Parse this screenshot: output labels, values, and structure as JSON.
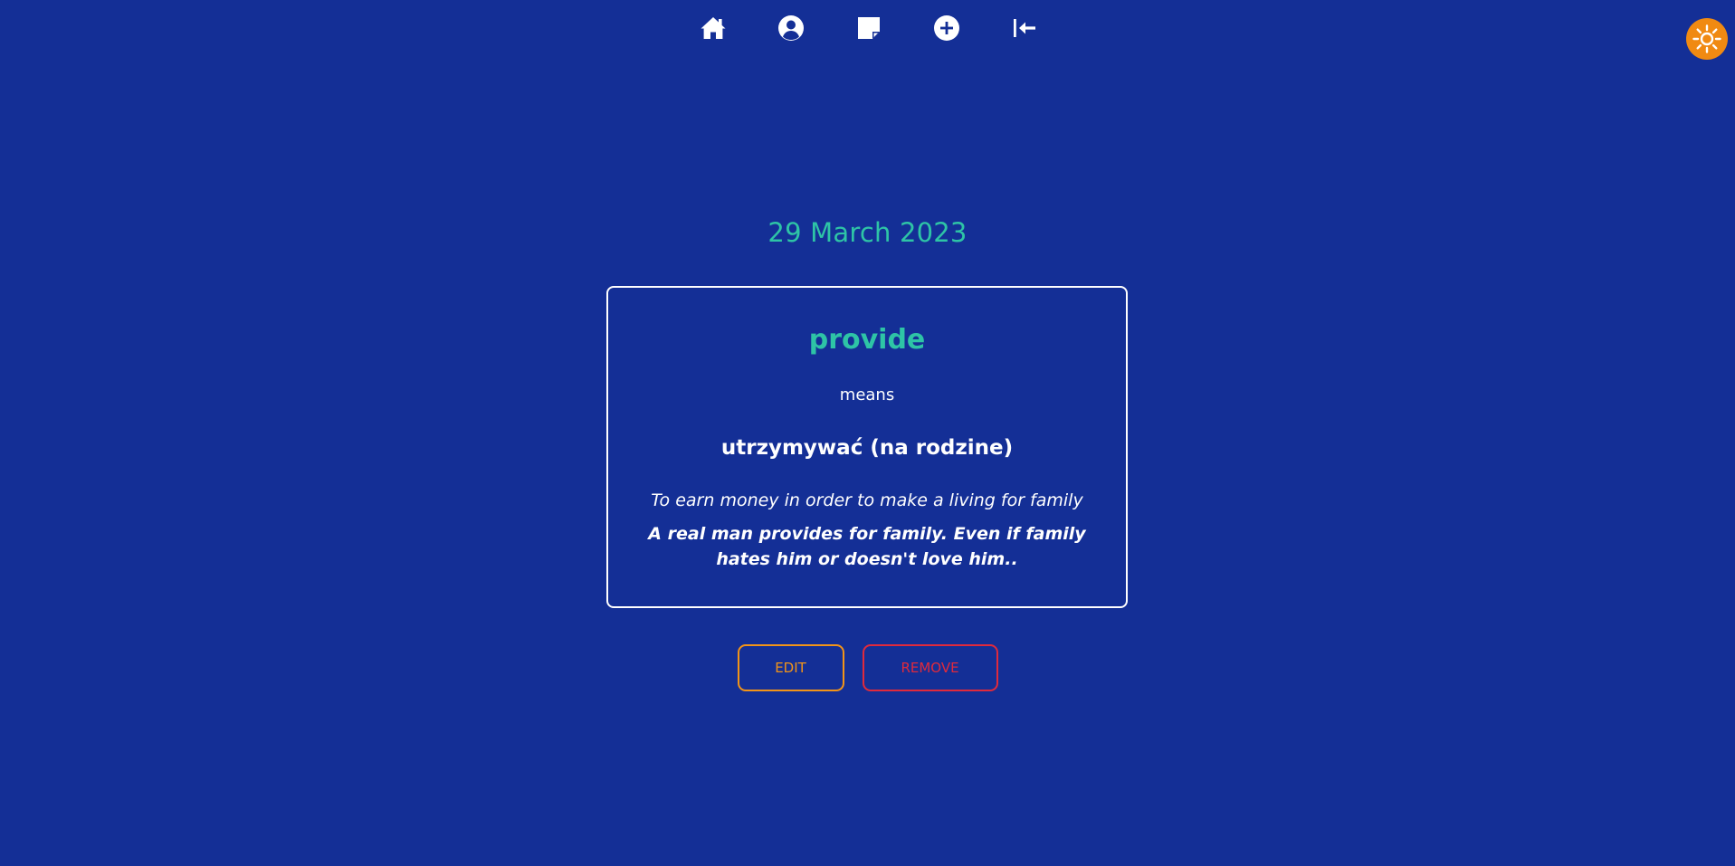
{
  "nav": {
    "items": [
      {
        "icon": "home-icon",
        "label": "Home"
      },
      {
        "icon": "user-icon",
        "label": "Profile"
      },
      {
        "icon": "note-icon",
        "label": "Notes"
      },
      {
        "icon": "plus-circle-icon",
        "label": "Add"
      },
      {
        "icon": "logout-icon",
        "label": "Log out"
      }
    ]
  },
  "theme_toggle": {
    "icon": "sun-icon",
    "color": "#f08a12"
  },
  "date": "29 March 2023",
  "card": {
    "word": "provide",
    "means_label": "means",
    "translation": "utrzymywać (na rodzine)",
    "definition": "To earn money in order to make a living for family",
    "example": "A real man provides for family. Even if family hates him or doesn't love him.."
  },
  "actions": {
    "edit_label": "EDIT",
    "remove_label": "REMOVE"
  },
  "colors": {
    "background": "#142f96",
    "accent": "#2ec4a6",
    "edit": "#f29418",
    "remove": "#e02a3c"
  }
}
